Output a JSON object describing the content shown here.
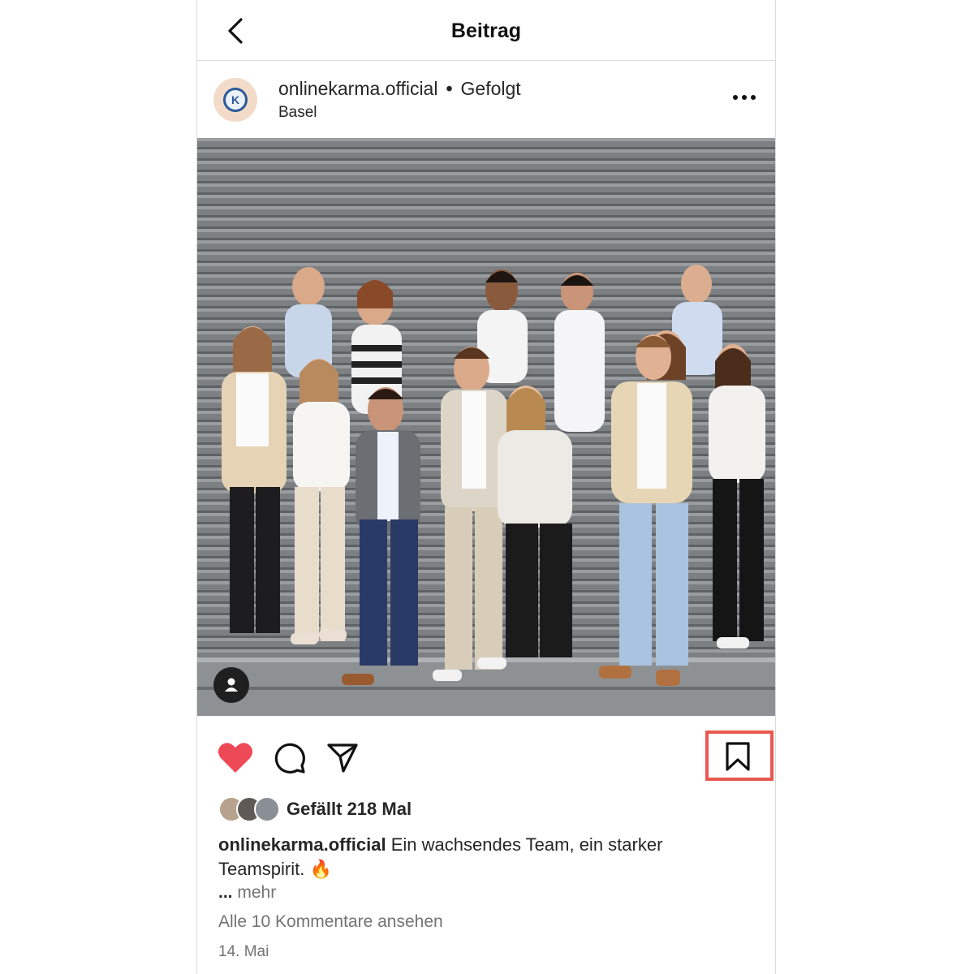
{
  "header": {
    "title": "Beitrag"
  },
  "post": {
    "username": "onlinekarma.official",
    "separator": "•",
    "follow_status": "Gefolgt",
    "location": "Basel",
    "avatar_letter": "K"
  },
  "actions": {
    "liked": true,
    "like_color": "#ed4956",
    "highlight_color": "#e8584f"
  },
  "likes": {
    "text": "Gefällt 218 Mal"
  },
  "caption": {
    "username": "onlinekarma.official",
    "text": "Ein wachsendes Team, ein starker Teamspirit. 🔥",
    "more_dots": "...",
    "more_label": "mehr"
  },
  "comments": {
    "view_all": "Alle 10 Kommentare ansehen"
  },
  "date": "14. Mai",
  "icons": [
    "back-arrow-icon",
    "more-options-icon",
    "tag-user-icon",
    "heart-icon",
    "comment-icon",
    "share-icon",
    "bookmark-icon"
  ]
}
